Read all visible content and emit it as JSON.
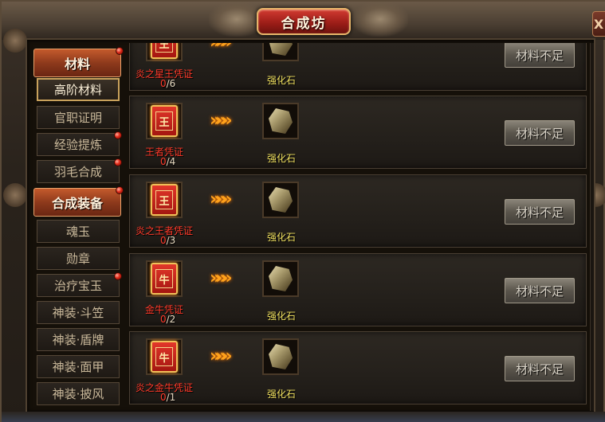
{
  "window": {
    "title": "合成坊",
    "close_label": "X"
  },
  "sidebar": {
    "groups": [
      {
        "label": "材料",
        "has_dot": true,
        "items": [
          {
            "label": "高阶材料",
            "active": true,
            "has_dot": false
          },
          {
            "label": "官职证明",
            "active": false,
            "has_dot": false
          },
          {
            "label": "经验提炼",
            "active": false,
            "has_dot": true
          },
          {
            "label": "羽毛合成",
            "active": false,
            "has_dot": true
          }
        ]
      },
      {
        "label": "合成装备",
        "has_dot": true,
        "items": [
          {
            "label": "魂玉",
            "active": false,
            "has_dot": false
          },
          {
            "label": "勋章",
            "active": false,
            "has_dot": false
          },
          {
            "label": "治疗宝玉",
            "active": false,
            "has_dot": true
          },
          {
            "label": "神装·斗笠",
            "active": false,
            "has_dot": false
          },
          {
            "label": "神装·盾牌",
            "active": false,
            "has_dot": false
          },
          {
            "label": "神装·面甲",
            "active": false,
            "has_dot": false
          },
          {
            "label": "神装·披风",
            "active": false,
            "has_dot": false
          }
        ]
      }
    ]
  },
  "recipes": [
    {
      "material_name": "炎之星王凭证",
      "material_glyph": "王",
      "have": "0",
      "need": "/6",
      "result_name": "强化石",
      "button_label": "材料不足"
    },
    {
      "material_name": "王者凭证",
      "material_glyph": "王",
      "have": "0",
      "need": "/4",
      "result_name": "强化石",
      "button_label": "材料不足"
    },
    {
      "material_name": "炎之王者凭证",
      "material_glyph": "王",
      "have": "0",
      "need": "/3",
      "result_name": "强化石",
      "button_label": "材料不足"
    },
    {
      "material_name": "金牛凭证",
      "material_glyph": "牛",
      "have": "0",
      "need": "/2",
      "result_name": "强化石",
      "button_label": "材料不足"
    },
    {
      "material_name": "炎之金牛凭证",
      "material_glyph": "牛",
      "have": "0",
      "need": "/1",
      "result_name": "强化石",
      "button_label": "材料不足"
    }
  ],
  "icons": {
    "arrow": "»»»",
    "result_icon": "enhance-stone-icon",
    "material_icon": "token-card-icon"
  },
  "colors": {
    "material_name": "#ff3a2a",
    "result_name": "#f0e060",
    "arrow": "#ffa21c",
    "title_plate": "#9e1e18"
  }
}
